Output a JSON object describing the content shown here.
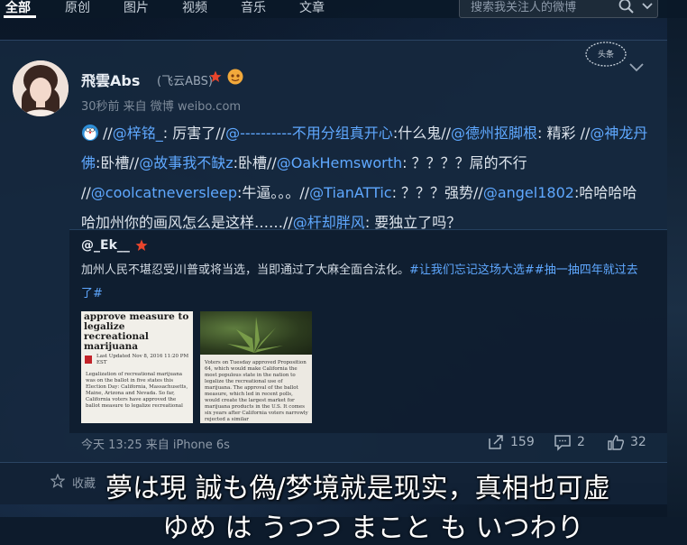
{
  "nav": {
    "tabs": [
      "全部",
      "原创",
      "图片",
      "视频",
      "音乐",
      "文章"
    ],
    "search_placeholder": "搜索我关注人的微博"
  },
  "post": {
    "username": "飛雲Abs",
    "alias": "(飞云ABS)",
    "meta": "30秒前 来自 微博 weibo.com",
    "stamp_text": "头条",
    "text_segments": [
      {
        "t": "//",
        "m": false
      },
      {
        "t": "@梓铭_",
        "m": true
      },
      {
        "t": ": 厉害了//",
        "m": false
      },
      {
        "t": "@----------不用分组真开心",
        "m": true
      },
      {
        "t": ":什么鬼//",
        "m": false
      },
      {
        "t": "@德州抠脚根",
        "m": true
      },
      {
        "t": ": 精彩 //",
        "m": false
      },
      {
        "t": "@神龙丹佛",
        "m": true
      },
      {
        "t": ":卧槽//",
        "m": false
      },
      {
        "t": "@故事我不缺z",
        "m": true
      },
      {
        "t": ":卧槽//",
        "m": false
      },
      {
        "t": "@OakHemsworth",
        "m": true
      },
      {
        "t": ": ？？？？屌的不行 //",
        "m": false
      },
      {
        "t": "@coolcatneversleep",
        "m": true
      },
      {
        "t": ":牛逼。。。//",
        "m": false
      },
      {
        "t": "@TianATTic",
        "m": true
      },
      {
        "t": ": ？？？强势//",
        "m": false
      },
      {
        "t": "@angel1802",
        "m": true
      },
      {
        "t": ":哈哈哈哈哈加州你的画风怎么是这样……//",
        "m": false
      },
      {
        "t": "@杆却胖风",
        "m": true
      },
      {
        "t": ": 要独立了吗？",
        "m": false
      }
    ]
  },
  "repost": {
    "user": "@_Ek__",
    "text": "加州人民不堪忍受川普或将当选，当即通过了大麻全面合法化。",
    "tags": "#让我们忘记这场大选##抽一抽四年就过去了#",
    "thumb1": {
      "headline": "approve measure to legalize recreational marijuana",
      "byline": "Last Updated Nov 8, 2016 11:20 PM EST",
      "body": "Legalization of recreational marijuana was on the ballot in five states this Election Day: California, Massachusetts, Maine, Arizona and Nevada. So far, California voters have approved the ballot measure to legalize recreational"
    },
    "thumb2": {
      "body": "Voters on Tuesday approved Proposition 64, which would make California the most populous state in the nation to legalize the recreational use of marijuana. The approval of the ballot measure, which led in recent polls, would create the largest market for marijuana products in the U.S. It comes six years after California voters narrowly rejected a similar"
    },
    "meta": "今天 13:25 来自 iPhone 6s",
    "shares": "159",
    "comments": "2",
    "likes": "32"
  },
  "footer": {
    "collect": "收藏"
  },
  "subtitle": {
    "line1": "夢は現 誠も偽/梦境就是现实，真相也可虚",
    "line2": "ゆめ は うつつ まこと も いつわり"
  }
}
